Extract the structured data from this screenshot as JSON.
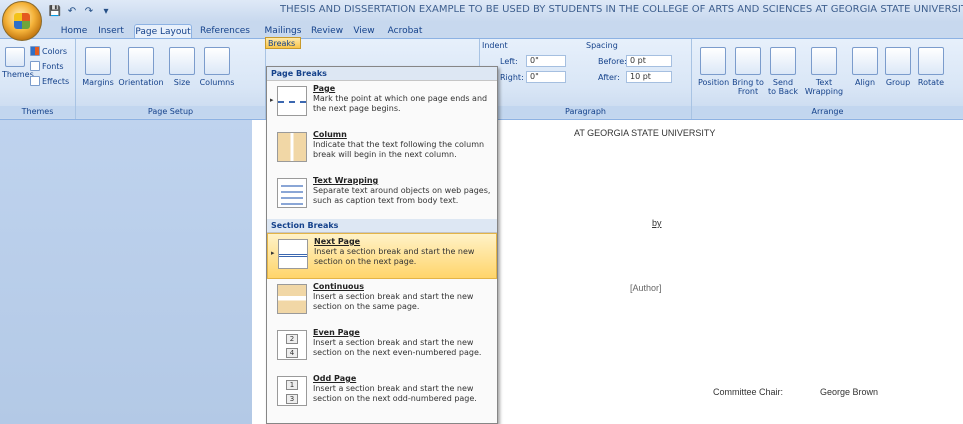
{
  "window": {
    "title": "THESIS AND DISSERTATION EXAMPLE TO BE USED BY STUDENTS IN THE COLLEGE OF ARTS AND SCIENCES AT GEORGIA STATE UNIVERSITY - Micr"
  },
  "tabs": [
    "Home",
    "Insert",
    "Page Layout",
    "References",
    "Mailings",
    "Review",
    "View",
    "Acrobat"
  ],
  "ribbon": {
    "themes": {
      "themes": "Themes",
      "colors": "Colors",
      "fonts": "Fonts",
      "effects": "Effects",
      "label": "Themes"
    },
    "page_setup": {
      "margins": "Margins",
      "orientation": "Orientation",
      "size": "Size",
      "columns": "Columns",
      "breaks": "Breaks",
      "label": "Page Setup"
    },
    "paragraph": {
      "indent": "Indent",
      "left": "Left:",
      "left_value": "0\"",
      "right": "Right:",
      "right_value": "0\"",
      "spacing": "Spacing",
      "before": "Before:",
      "before_value": "0 pt",
      "after": "After:",
      "after_value": "10 pt",
      "label": "Paragraph"
    },
    "arrange": {
      "position": "Position",
      "bring_front": "Bring to Front",
      "send_back": "Send to Back",
      "text_wrapping": "Text Wrapping",
      "align": "Align",
      "group": "Group",
      "rotate": "Rotate",
      "label": "Arrange"
    }
  },
  "menu": {
    "page_breaks_header": "Page Breaks",
    "section_breaks_header": "Section Breaks",
    "items": [
      {
        "title": "Page",
        "desc": "Mark the point at which one page ends and the next page begins."
      },
      {
        "title": "Column",
        "desc": "Indicate that the text following the column break will begin in the next column."
      },
      {
        "title": "Text Wrapping",
        "desc": "Separate text around objects on web pages, such as caption text from body text."
      },
      {
        "title": "Next Page",
        "desc": "Insert a section break and start the new section on the next page."
      },
      {
        "title": "Continuous",
        "desc": "Insert a section break and start the new section on the same page."
      },
      {
        "title": "Even Page",
        "desc": "Insert a section break and start the new section on the next even-numbered page."
      },
      {
        "title": "Odd Page",
        "desc": "Insert a section break and start the new section on the next odd-numbered page."
      }
    ],
    "even_icon_numbers": [
      "2",
      "4"
    ],
    "odd_icon_numbers": [
      "1",
      "3"
    ]
  },
  "document": {
    "university": "AT GEORGIA STATE UNIVERSITY",
    "by": "by",
    "author": "[Author]",
    "committee_chair_label": "Committee Chair:",
    "committee_chair_name": "George Brown"
  }
}
